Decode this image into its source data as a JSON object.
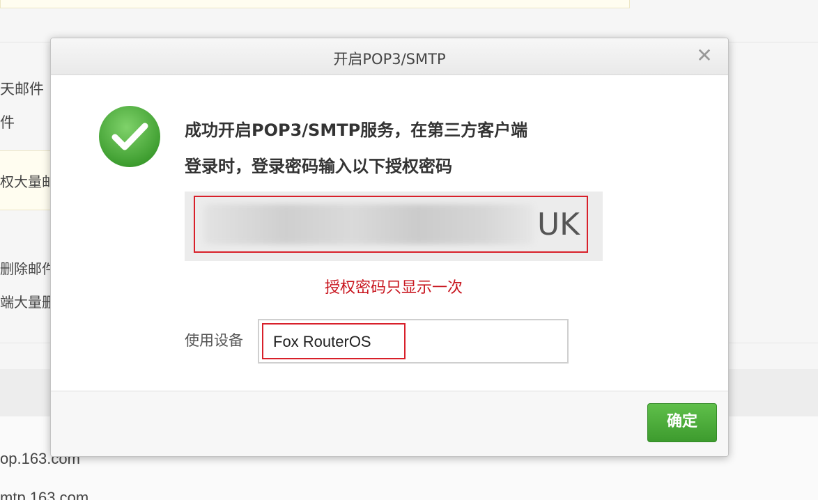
{
  "background": {
    "left_texts": [
      "天邮件",
      "件",
      "权大量邮",
      "删除邮件",
      "端大量删"
    ],
    "bottom_texts": [
      "op.163.com",
      "mtp.163.com"
    ]
  },
  "dialog": {
    "title": "开启POP3/SMTP",
    "close_glyph": "✕",
    "icon": "success-check-icon",
    "message_line1": "成功开启POP3/SMTP服务，在第三方客户端",
    "message_line2": "登录时，登录密码输入以下授权密码",
    "auth_code_visible_suffix": "UK",
    "warning": "授权密码只显示一次",
    "device_label": "使用设备",
    "device_value": "Fox RouterOS",
    "confirm_label": "确定"
  },
  "colors": {
    "accent_green": "#4caf3a",
    "warning_red": "#c8151e",
    "highlight_red": "#d8202a"
  }
}
